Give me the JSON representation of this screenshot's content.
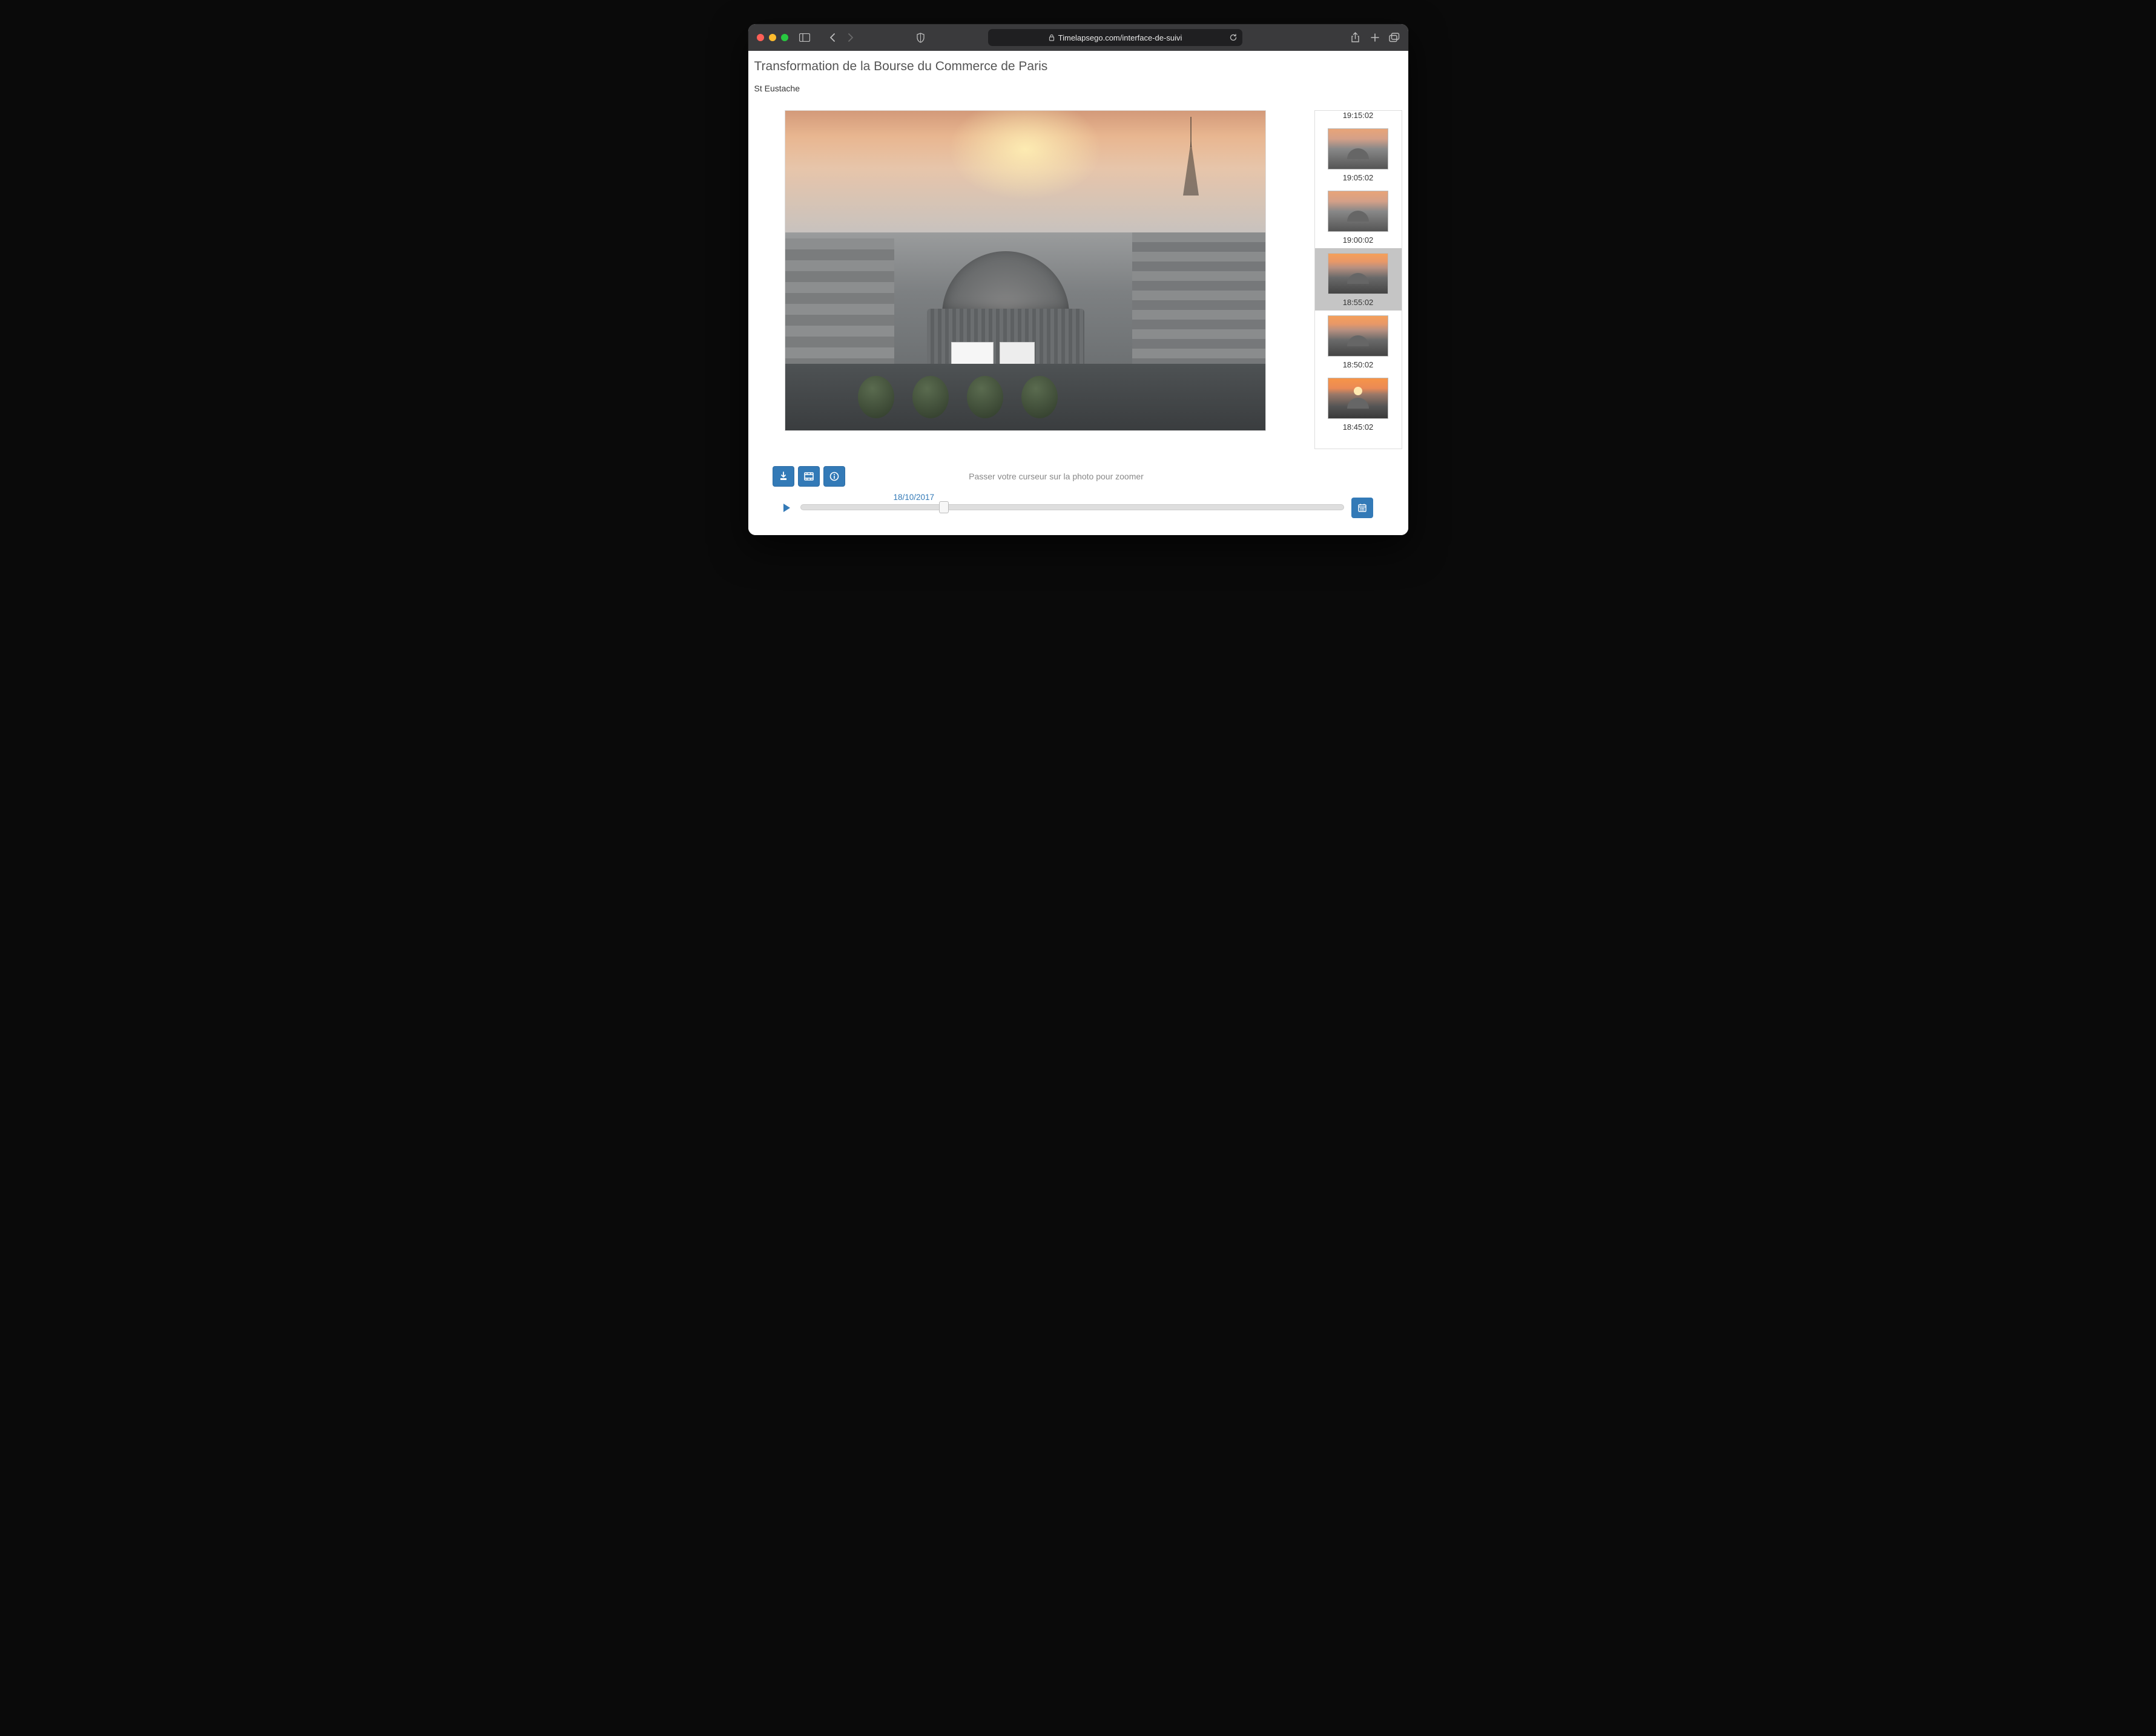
{
  "browser": {
    "url_display": "Timelapsego.com/interface-de-suivi"
  },
  "page": {
    "title": "Transformation de la Bourse du Commerce de Paris",
    "subtitle": "St Eustache",
    "hint": "Passer votre curseur sur la photo pour zoomer",
    "date_label": "18/10/2017"
  },
  "thumbnails": [
    {
      "time": "19:15:02",
      "selected": false,
      "partial_top": true
    },
    {
      "time": "19:05:02",
      "selected": false
    },
    {
      "time": "19:00:02",
      "selected": false
    },
    {
      "time": "18:55:02",
      "selected": true
    },
    {
      "time": "18:50:02",
      "selected": false
    },
    {
      "time": "18:45:02",
      "selected": false
    }
  ],
  "slider": {
    "min": 0,
    "max": 100,
    "value": 26
  }
}
